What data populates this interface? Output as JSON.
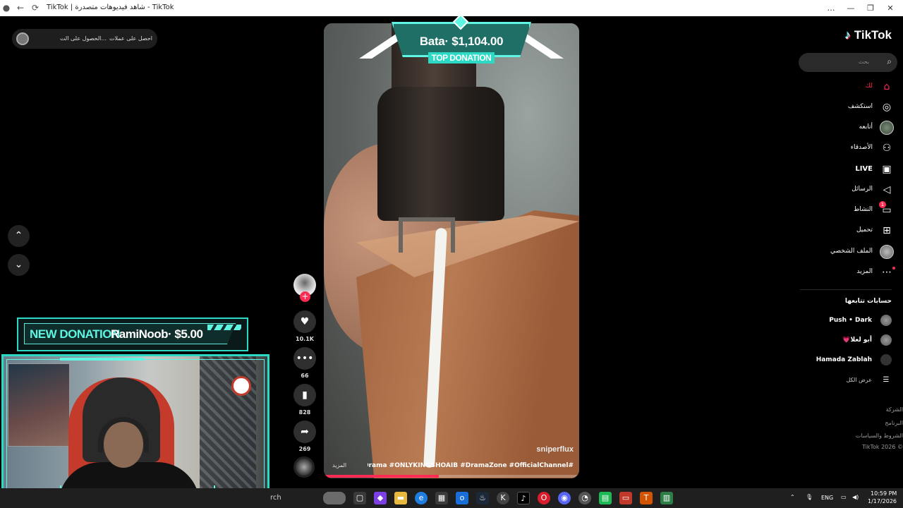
{
  "window": {
    "title": "TikTok | شاهد فيديوهات متصدرة - TikTok",
    "controls": [
      "…",
      "—",
      "❐",
      "✕"
    ]
  },
  "top_left": {
    "get_coins": "احصل على عملات",
    "get_app": "الحصول على الت..."
  },
  "donation_banner": {
    "label": "NEW DONATION",
    "donor": "RamiNoob· $5.00"
  },
  "top_donation": {
    "amount": "Bata· $1,104.00",
    "tag": "TOP DONATION"
  },
  "video": {
    "watermark": "sniperflux",
    "hashtags": "#PakistaniDrama #ONLYKINGSHOAIB #DramaZone #OfficialChannel...",
    "more": "المزيد",
    "progress": 0.45
  },
  "actions": {
    "likes": "10.1K",
    "comments": "66",
    "saves": "828",
    "shares": "269"
  },
  "sidebar": {
    "logo": "TikTok",
    "search_placeholder": "بحث",
    "nav": [
      {
        "label": "لك",
        "icon": "home-icon"
      },
      {
        "label": "استكشف",
        "icon": "compass-icon"
      },
      {
        "label": "أتابعه",
        "icon": "avatar"
      },
      {
        "label": "الأصدقاء",
        "icon": "friends-icon"
      },
      {
        "label": "LIVE",
        "icon": "live-icon"
      },
      {
        "label": "الرسائل",
        "icon": "messages-icon"
      },
      {
        "label": "النشاط",
        "icon": "activity-icon",
        "badge": "1"
      },
      {
        "label": "تحميل",
        "icon": "upload-icon"
      },
      {
        "label": "الملف الشخصي",
        "icon": "profile-icon"
      },
      {
        "label": "المزيد",
        "icon": "more-icon"
      }
    ],
    "following_title": "حسابات تتابعها",
    "following": [
      {
        "name": "Push • Dark"
      },
      {
        "name": "أبو لعلا💗"
      },
      {
        "name": "Hamada Zablah"
      }
    ],
    "see_all": "عرض الكل",
    "footer": [
      "الشركة",
      "البرنامج",
      "الشروط والسياسات",
      "© 2026 TikTok"
    ]
  },
  "taskbar": {
    "search_text": "rch",
    "lang": "ENG",
    "time": "10:59 PM",
    "date": "1/17/2026"
  },
  "colors": {
    "accent": "#fe2c55",
    "overlay_teal": "#5ef5e3"
  }
}
